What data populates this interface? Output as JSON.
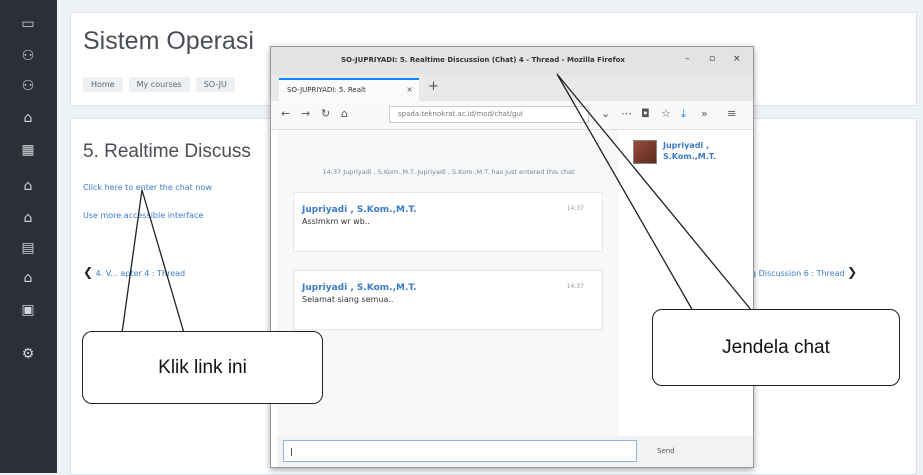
{
  "sidebar": {
    "icons": [
      "folder-icon",
      "users-icon",
      "users-icon",
      "home-icon",
      "calendar-icon",
      "graduation-icon",
      "graduation-icon",
      "calendar-icon",
      "graduation-icon",
      "file-icon",
      "gear-icon"
    ]
  },
  "header": {
    "site_title": "Sistem Operasi",
    "breadcrumbs": [
      "Home",
      "My courses",
      "SO-JU"
    ]
  },
  "activity": {
    "title": "5. Realtime Discuss",
    "enter_link": "Click here to enter the chat now",
    "accessible_link": "Use more accessible interface",
    "prev_link": "4. V... apter 4 : Thread",
    "next_link": "g Discussion 6 : Thread"
  },
  "browser": {
    "window_title": "SO-JUPRIYADI: 5. Realtime Discussion (Chat) 4 - Thread - Mozilla Firefox",
    "tab_label": "SO-JUPRIYADI: 5. Realt",
    "url": "spada.teknokrat.ac.id/mod/chat/gui",
    "controls": {
      "minimize": "–",
      "maximize": "▫",
      "close": "×"
    }
  },
  "chat": {
    "system_message": "14:37 Jupriyadi , S.Kom.,M.T. Jupriyadi , S.Kom.,M.T. has just entered this chat",
    "messages": [
      {
        "user": "Jupriyadi , S.Kom.,M.T.",
        "time": "14:37",
        "text": "Asslmkm wr wb.."
      },
      {
        "user": "Jupriyadi , S.Kom.,M.T.",
        "time": "14:37",
        "text": "Selamat siang semua.."
      }
    ],
    "online_user": "Jupriyadi , S.Kom.,M.T.",
    "input_value": "|",
    "send_label": "Send"
  },
  "callouts": {
    "left": "Klik link ini",
    "right": "Jendela chat"
  }
}
